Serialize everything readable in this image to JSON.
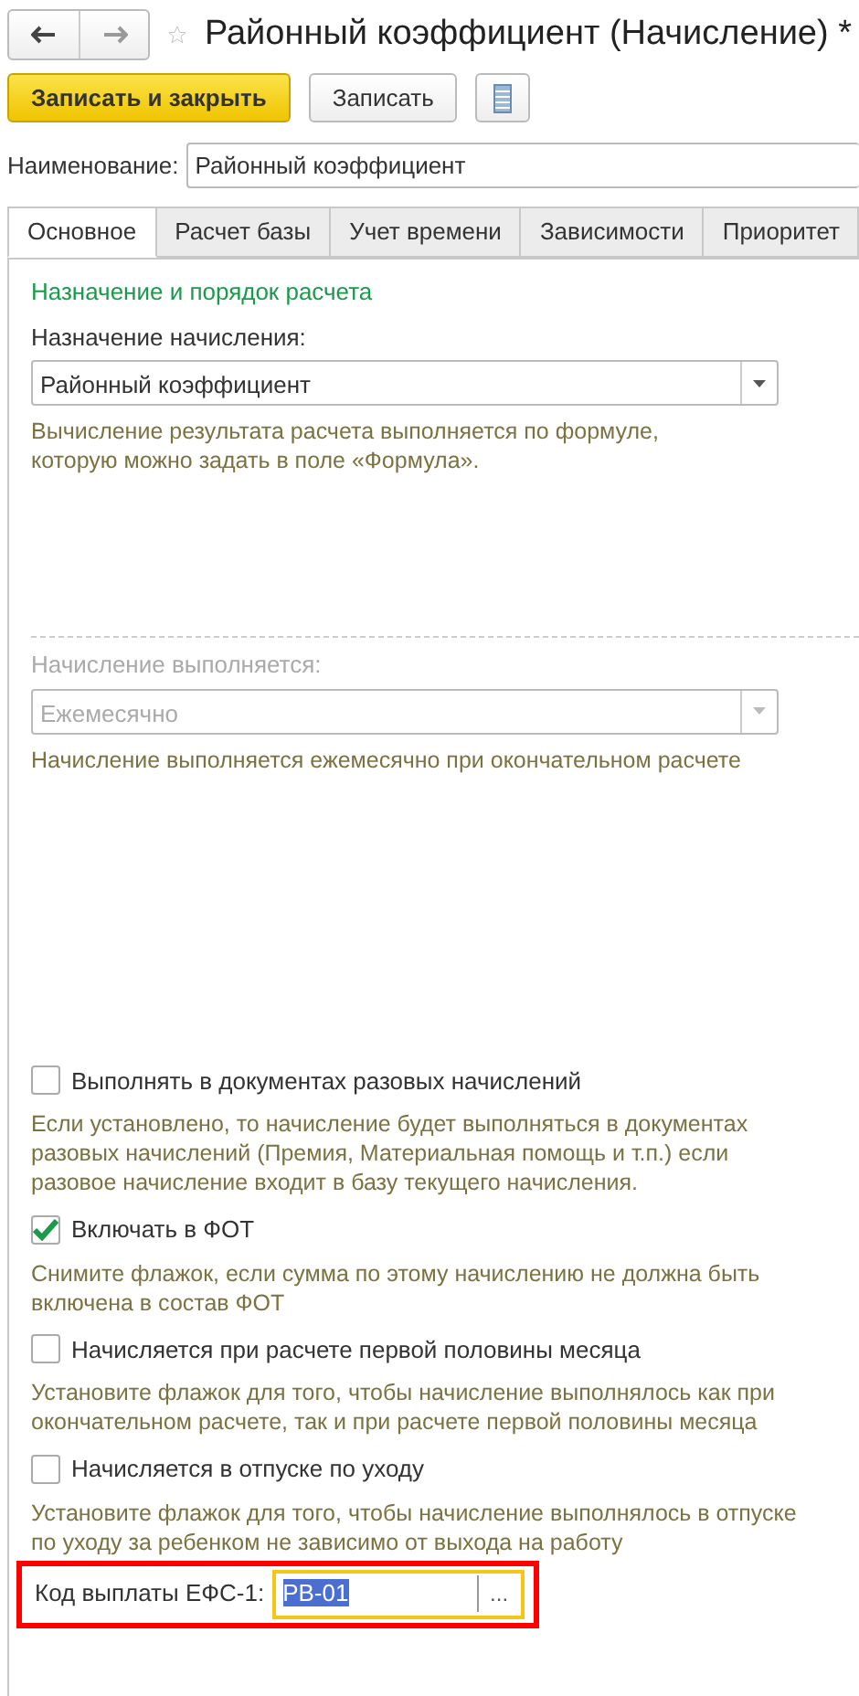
{
  "window": {
    "title": "Районный коэффициент (Начисление) *",
    "favorite": false
  },
  "toolbar": [
    {
      "kind": "primary",
      "label": "Записать и закрыть"
    },
    {
      "kind": "default",
      "label": "Записать"
    },
    {
      "kind": "icon"
    }
  ],
  "name_field": {
    "label": "Наименование:",
    "value": "Районный коэффициент"
  },
  "tabs": [
    {
      "label": "Основное",
      "selected": true
    },
    {
      "label": "Расчет базы",
      "selected": false
    },
    {
      "label": "Учет времени",
      "selected": false
    },
    {
      "label": "Зависимости",
      "selected": false
    },
    {
      "label": "Приоритет",
      "selected": false
    }
  ],
  "section": {
    "title": "Назначение и порядок расчета"
  },
  "purpose": {
    "label": "Назначение начисления:",
    "value": "Районный коэффициент",
    "disabled": false,
    "hint": "Вычисление результата расчета выполняется по формуле, которую можно задать в поле «Формула»."
  },
  "schedule": {
    "label": "Начисление выполняется:",
    "value": "Ежемесячно",
    "disabled": true,
    "hint": "Начисление выполняется ежемесячно при окончательном расчете"
  },
  "checkboxes": [
    {
      "label": "Выполнять в документах разовых начислений",
      "checked": false,
      "hint": "Если установлено, то начисление будет выполняться в документах разовых начислений (Премия, Материальная помощь и т.п.) если разовое начисление входит в базу текущего начисления."
    },
    {
      "label": "Включать в ФОТ",
      "checked": true,
      "hint": "Снимите флажок, если сумма по этому начислению не должна быть включена в состав ФОТ"
    },
    {
      "label": "Начисляется при расчете первой половины месяца",
      "checked": false,
      "hint": "Установите флажок для того, чтобы начисление выполнялось как при окончательном расчете, так и при расчете первой половины месяца"
    },
    {
      "label": "Начисляется в отпуске по уходу",
      "checked": false,
      "hint": "Установите флажок для того, чтобы начисление выполнялось в отпуске по уходу за ребенком не зависимо от выхода на работу"
    }
  ],
  "efs_field": {
    "label": "Код выплаты ЕФС-1:",
    "value": "РВ-01",
    "button": "...",
    "focused": true,
    "highlighted": true
  }
}
